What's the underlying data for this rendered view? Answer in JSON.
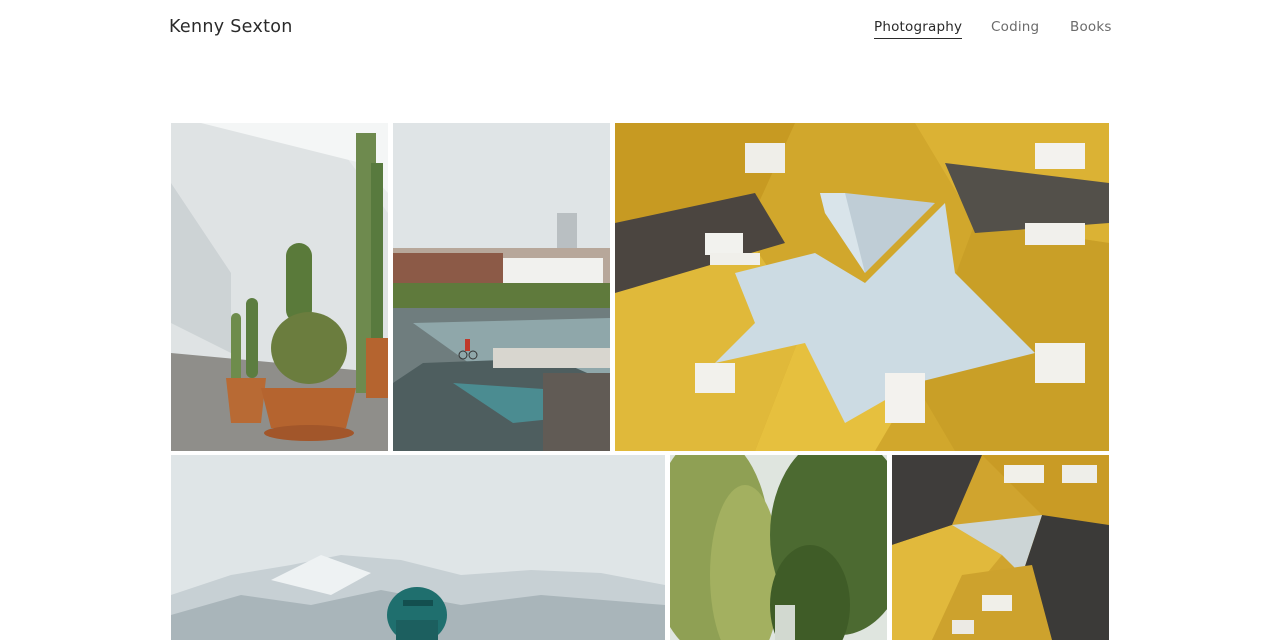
{
  "site": {
    "title": "Kenny Sexton"
  },
  "nav": {
    "items": [
      {
        "label": "Photography",
        "active": true
      },
      {
        "label": "Coding",
        "active": false
      },
      {
        "label": "Books",
        "active": false
      }
    ]
  },
  "gallery": {
    "photos": [
      {
        "subject": "cactus-plants"
      },
      {
        "subject": "city-rooftop-cyclist"
      },
      {
        "subject": "yellow-cube-houses-sky"
      },
      {
        "subject": "cyclist-helmet-snowy-mountains"
      },
      {
        "subject": "willow-trees"
      },
      {
        "subject": "yellow-cube-houses"
      }
    ]
  },
  "colors": {
    "accent": "#2a2a2a",
    "nav_inactive": "#6b6b6b",
    "background": "#ffffff"
  }
}
